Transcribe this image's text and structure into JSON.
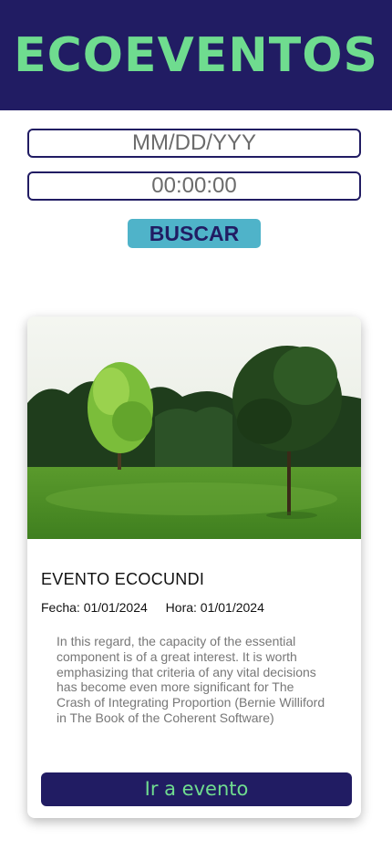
{
  "header": {
    "brand": "ECOEVENTOS"
  },
  "search": {
    "date_placeholder": "MM/DD/YYY",
    "time_value": "00:00:00",
    "button_label": "BUSCAR"
  },
  "event": {
    "title": "EVENTO ECOCUNDI",
    "fecha_label": "Fecha:",
    "fecha_value": "01/01/2024",
    "hora_label": "Hora:",
    "hora_value": "01/01/2024",
    "description": "In this regard, the capacity of the essential component is of a great interest. It is worth emphasizing that criteria of any vital decisions has become even more significant for The Crash of Integrating Proportion (Bernie Williford in The Book of the Coherent Software)",
    "button_label": "Ir a evento"
  },
  "colors": {
    "header_bg": "#211c63",
    "brand_green": "#6fdc8f",
    "search_button_bg": "#4fb3c9"
  }
}
